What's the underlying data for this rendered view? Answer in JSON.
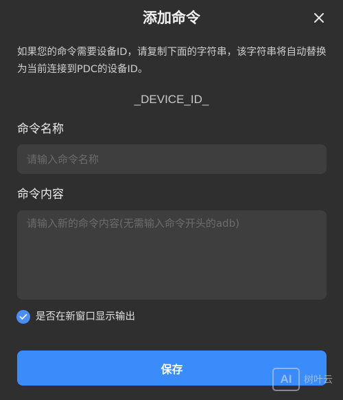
{
  "dialog": {
    "title": "添加命令",
    "description": "如果您的命令需要设备ID，请复制下面的字符串，该字符串将自动替换为当前连接到PDC的设备ID。",
    "device_id_token": "_DEVICE_ID_"
  },
  "form": {
    "name_label": "命令名称",
    "name_value": "",
    "name_placeholder": "请输入命令名称",
    "content_label": "命令内容",
    "content_value": "",
    "content_placeholder": "请输入新的命令内容(无需输入命令开头的adb)",
    "new_window_label": "是否在新窗口显示输出",
    "new_window_checked": true
  },
  "actions": {
    "save_label": "保存"
  },
  "watermark": {
    "logo_text": "AI",
    "text": "树叶云"
  },
  "icons": {
    "close": "close-icon",
    "check": "check-icon"
  },
  "colors": {
    "background": "#2f2f2f",
    "input_background": "#3e3e3e",
    "accent": "#3b8cfb",
    "checkbox": "#4a8ff7"
  }
}
